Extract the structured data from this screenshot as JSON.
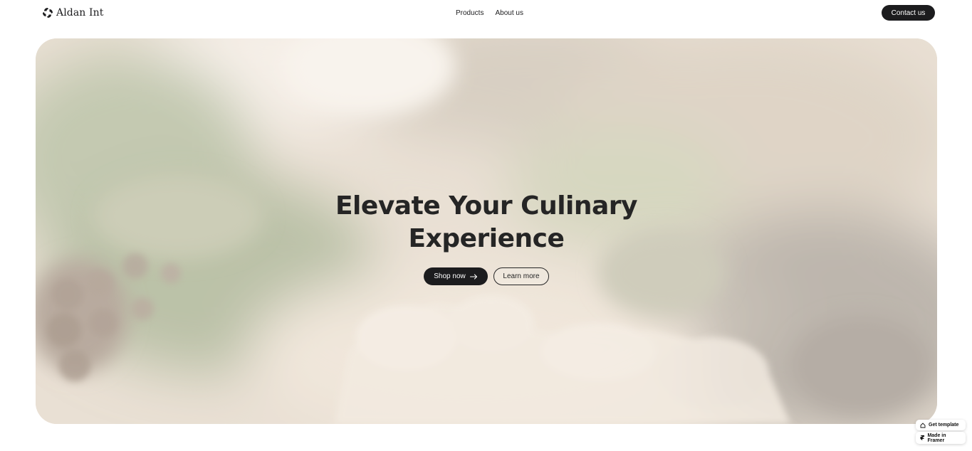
{
  "header": {
    "brand_name": "Aldan Int",
    "logo_icon": "swirl-logo-icon",
    "nav": [
      {
        "label": "Products"
      },
      {
        "label": "About us"
      }
    ],
    "contact_label": "Contact us"
  },
  "hero": {
    "title_line1": "Elevate Your Culinary",
    "title_line2": "Experience",
    "primary_button": {
      "label": "Shop now",
      "icon": "arrow-right-icon"
    },
    "secondary_button": {
      "label": "Learn more"
    },
    "background_image": "blurred close-up of spices, peppercorns and herbs"
  },
  "badges": {
    "get_template": {
      "label": "Get template",
      "icon": "template-icon"
    },
    "made_in_framer": {
      "label": "Made in Framer",
      "icon": "framer-icon"
    }
  },
  "colors": {
    "dark": "#1c1c1e",
    "hero_tint": "#ece2d6"
  }
}
